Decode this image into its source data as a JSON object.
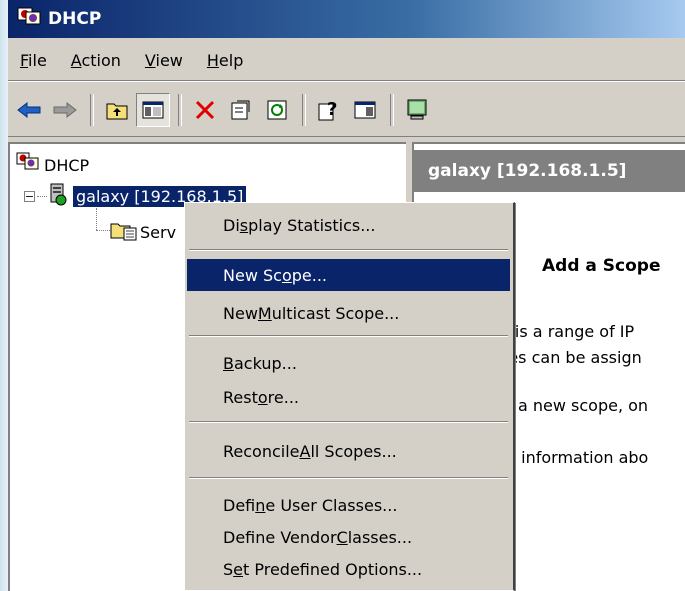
{
  "window": {
    "title": "DHCP"
  },
  "menubar": {
    "items": [
      {
        "pre": "",
        "key": "F",
        "post": "ile"
      },
      {
        "pre": "",
        "key": "A",
        "post": "ction"
      },
      {
        "pre": "",
        "key": "V",
        "post": "iew"
      },
      {
        "pre": "",
        "key": "H",
        "post": "elp"
      }
    ]
  },
  "toolbar": {
    "buttons": [
      "back-icon",
      "forward-icon",
      "up-folder-icon",
      "show-hide-tree-icon",
      "delete-icon",
      "properties-icon",
      "refresh-icon",
      "help-icon",
      "action-pane-icon",
      "monitor-icon"
    ]
  },
  "tree": {
    "root_label": "DHCP",
    "server_label": "galaxy [192.168.1.5]",
    "child_label": "Serv"
  },
  "right": {
    "header": "galaxy [192.168.1.5]",
    "title": "Add a Scope",
    "lines": [
      "e is a range of IP",
      "ses can be assign",
      "a new scope, on",
      "re information abo"
    ]
  },
  "context_menu": {
    "items": [
      {
        "pre": "Di",
        "key": "s",
        "post": "play Statistics..."
      },
      {
        "pre": "New Sc",
        "key": "o",
        "post": "pe..."
      },
      {
        "pre": "New ",
        "key": "M",
        "post": "ulticast Scope..."
      },
      {
        "pre": "",
        "key": "B",
        "post": "ackup..."
      },
      {
        "pre": "Rest",
        "key": "o",
        "post": "re..."
      },
      {
        "pre": "Reconcile ",
        "key": "A",
        "post": "ll Scopes..."
      },
      {
        "pre": "Defi",
        "key": "n",
        "post": "e User Classes..."
      },
      {
        "pre": "Define Vendor ",
        "key": "C",
        "post": "lasses..."
      },
      {
        "pre": "S",
        "key": "e",
        "post": "t Predefined Options..."
      }
    ]
  },
  "colors": {
    "selection": "#0a246a",
    "window_face": "#d4d0c8",
    "header_gray": "#808080"
  }
}
